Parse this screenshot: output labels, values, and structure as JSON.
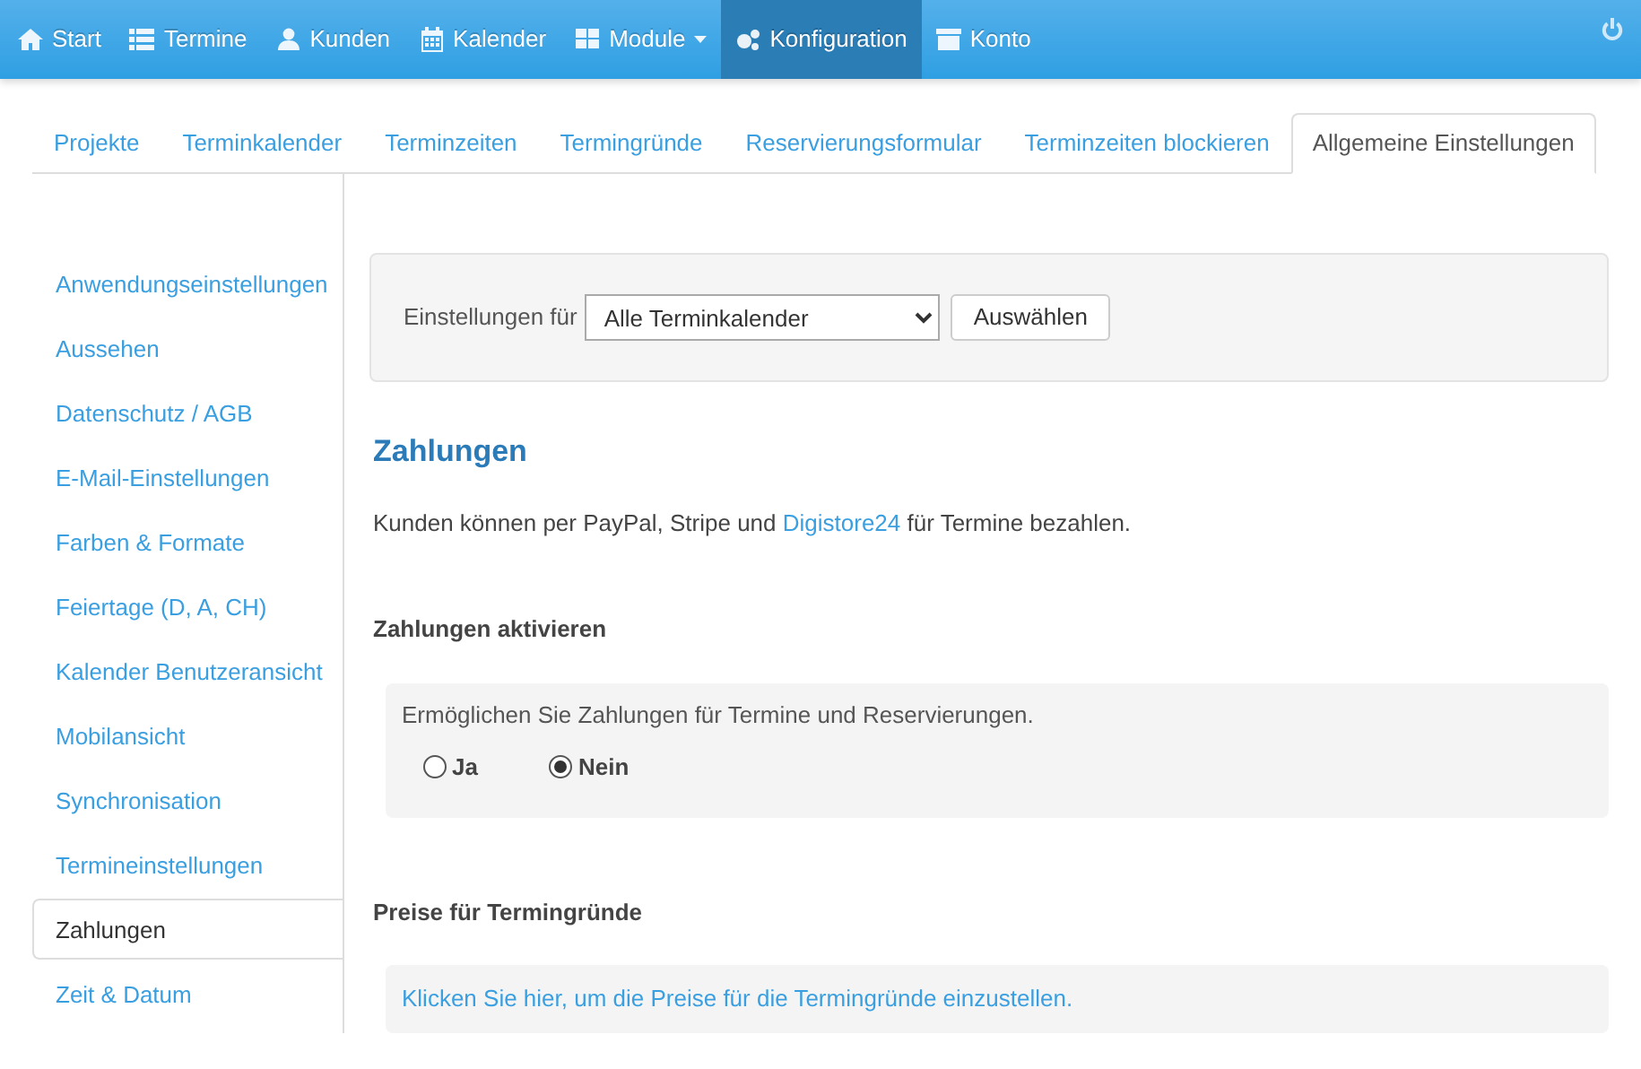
{
  "navbar": {
    "items": [
      {
        "label": "Start",
        "selected": false,
        "dropdown": false
      },
      {
        "label": "Termine",
        "selected": false,
        "dropdown": false
      },
      {
        "label": "Kunden",
        "selected": false,
        "dropdown": false
      },
      {
        "label": "Kalender",
        "selected": false,
        "dropdown": false
      },
      {
        "label": "Module",
        "selected": false,
        "dropdown": true
      },
      {
        "label": "Konfiguration",
        "selected": true,
        "dropdown": false
      },
      {
        "label": "Konto",
        "selected": false,
        "dropdown": false
      }
    ]
  },
  "tabs": [
    {
      "label": "Projekte",
      "selected": false
    },
    {
      "label": "Terminkalender",
      "selected": false
    },
    {
      "label": "Terminzeiten",
      "selected": false
    },
    {
      "label": "Termingründe",
      "selected": false
    },
    {
      "label": "Reservierungsformular",
      "selected": false
    },
    {
      "label": "Terminzeiten blockieren",
      "selected": false
    },
    {
      "label": "Allgemeine Einstellungen",
      "selected": true
    }
  ],
  "sidebar": {
    "items": [
      {
        "label": "Anwendungseinstellungen",
        "selected": false
      },
      {
        "label": "Aussehen",
        "selected": false
      },
      {
        "label": "Datenschutz / AGB",
        "selected": false
      },
      {
        "label": "E-Mail-Einstellungen",
        "selected": false
      },
      {
        "label": "Farben & Formate",
        "selected": false
      },
      {
        "label": "Feiertage (D, A, CH)",
        "selected": false
      },
      {
        "label": "Kalender Benutzeransicht",
        "selected": false
      },
      {
        "label": "Mobilansicht",
        "selected": false
      },
      {
        "label": "Synchronisation",
        "selected": false
      },
      {
        "label": "Termineinstellungen",
        "selected": false
      },
      {
        "label": "Zahlungen",
        "selected": true
      },
      {
        "label": "Zeit & Datum",
        "selected": false
      }
    ]
  },
  "filter": {
    "label": "Einstellungen für",
    "select_value": "Alle Terminkalender",
    "button": "Auswählen"
  },
  "section": {
    "title": "Zahlungen",
    "intro_before": "Kunden können per PayPal, Stripe und",
    "intro_link": "Digistore24",
    "intro_after": "für Termine bezahlen."
  },
  "activate": {
    "title": "Zahlungen aktivieren",
    "text": "Ermöglichen Sie Zahlungen für Termine und Reservierungen.",
    "options": [
      {
        "label": "Ja",
        "selected": false
      },
      {
        "label": "Nein",
        "selected": true
      }
    ]
  },
  "prices": {
    "title": "Preise für Termingründe",
    "link": "Klicken Sie hier, um die Preise für die Termingründe einzustellen."
  }
}
